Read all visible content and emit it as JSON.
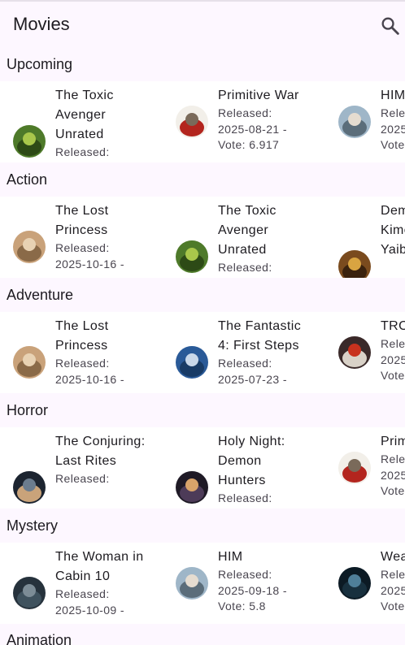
{
  "app": {
    "title": "Movies",
    "search_icon": "search-icon"
  },
  "sections": [
    {
      "title": "Upcoming",
      "movies": [
        {
          "title": "The Toxic Avenger Unrated",
          "released_label": "Released:",
          "date_line": "",
          "vote_line": ""
        },
        {
          "title": "Primitive War",
          "released_label": "Released:",
          "date_line": "2025-08-21 -",
          "vote_line": "Vote: 6.917"
        },
        {
          "title": "HIM",
          "released_label": "Relea",
          "date_line": "2025",
          "vote_line": "Vote"
        }
      ]
    },
    {
      "title": "Action",
      "movies": [
        {
          "title": "The Lost Princess",
          "released_label": "Released:",
          "date_line": "2025-10-16 -",
          "vote_line": ""
        },
        {
          "title": "The Toxic Avenger Unrated",
          "released_label": "Released:",
          "date_line": "",
          "vote_line": ""
        },
        {
          "title": "Demon Slayer: Kimetsu no Yaiba",
          "released_label": "",
          "date_line": "",
          "vote_line": ""
        }
      ]
    },
    {
      "title": "Adventure",
      "movies": [
        {
          "title": "The Lost Princess",
          "released_label": "Released:",
          "date_line": "2025-10-16 -",
          "vote_line": ""
        },
        {
          "title": "The Fantastic 4: First Steps",
          "released_label": "Released:",
          "date_line": "2025-07-23 -",
          "vote_line": ""
        },
        {
          "title": "TRO",
          "released_label": "Relea",
          "date_line": "2025",
          "vote_line": "Vote"
        }
      ]
    },
    {
      "title": "Horror",
      "movies": [
        {
          "title": "The Conjuring: Last Rites",
          "released_label": "Released:",
          "date_line": "",
          "vote_line": ""
        },
        {
          "title": "Holy Night: Demon Hunters",
          "released_label": "Released:",
          "date_line": "",
          "vote_line": ""
        },
        {
          "title": "Prim",
          "released_label": "Relea",
          "date_line": "2025",
          "vote_line": "Vote"
        }
      ]
    },
    {
      "title": "Mystery",
      "movies": [
        {
          "title": "The Woman in Cabin 10",
          "released_label": "Released:",
          "date_line": "2025-10-09 -",
          "vote_line": ""
        },
        {
          "title": "HIM",
          "released_label": "Released:",
          "date_line": "2025-09-18 -",
          "vote_line": "Vote: 5.8"
        },
        {
          "title": "Wea",
          "released_label": "Relea",
          "date_line": "2025",
          "vote_line": "Vote"
        }
      ]
    },
    {
      "title": "Animation",
      "movies": []
    }
  ],
  "poster_art": {
    "toxic": {
      "bg": "#4e7a2a",
      "fg": "#a9c74b",
      "accent": "#2d4a16"
    },
    "primitive": {
      "bg": "#f2efe9",
      "fg": "#7a6a5a",
      "accent": "#b3251e"
    },
    "him": {
      "bg": "#9fb6c8",
      "fg": "#e5dcd0",
      "accent": "#5b6d7a"
    },
    "lost": {
      "bg": "#c9a27a",
      "fg": "#e8d2b3",
      "accent": "#8a6a48"
    },
    "demon": {
      "bg": "#7a4b1e",
      "fg": "#d9a441",
      "accent": "#3a220e"
    },
    "fantastic": {
      "bg": "#2a5a98",
      "fg": "#c9d8ea",
      "accent": "#183b66"
    },
    "tron": {
      "bg": "#3a2a2a",
      "fg": "#c8321e",
      "accent": "#d9d2c8"
    },
    "conjuring": {
      "bg": "#1c2430",
      "fg": "#6b7c8e",
      "accent": "#c9a37a"
    },
    "holy": {
      "bg": "#1f1a26",
      "fg": "#d8a36a",
      "accent": "#4d3b58"
    },
    "cabin": {
      "bg": "#26323c",
      "fg": "#7c8c96",
      "accent": "#3f525e"
    },
    "weapons": {
      "bg": "#0c1a24",
      "fg": "#4f7f99",
      "accent": "#18303e"
    }
  }
}
